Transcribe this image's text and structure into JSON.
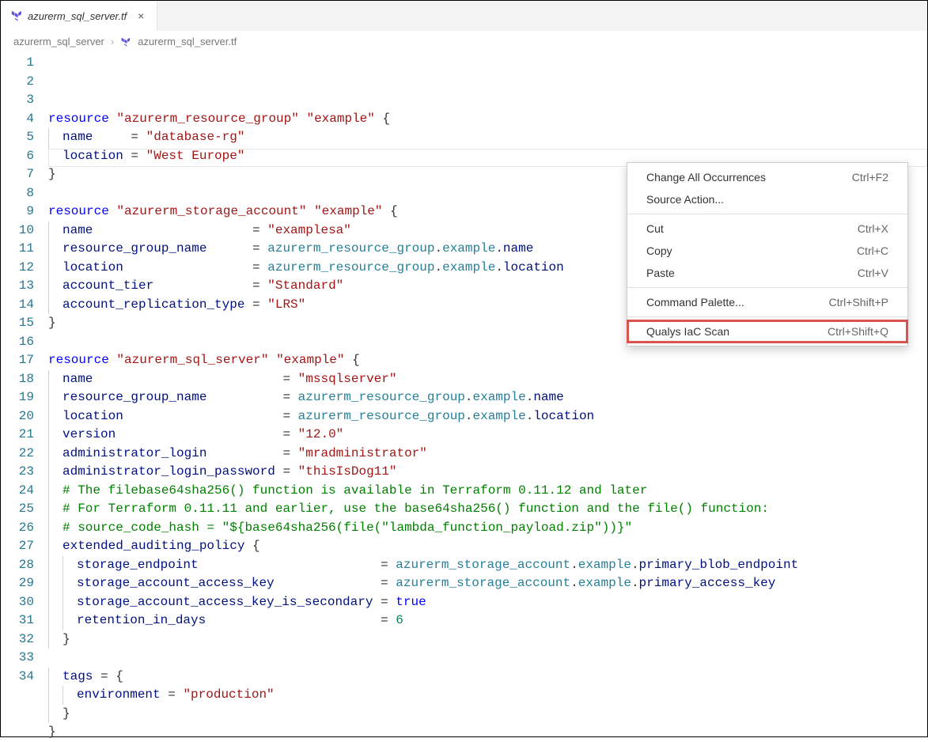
{
  "tab": {
    "filename": "azurerm_sql_server.tf"
  },
  "breadcrumbs": {
    "folder": "azurerm_sql_server",
    "file": "azurerm_sql_server.tf"
  },
  "code": {
    "lines": [
      [
        {
          "t": "kw",
          "v": "resource"
        },
        {
          "t": "",
          "v": " "
        },
        {
          "t": "str",
          "v": "\"azurerm_resource_group\""
        },
        {
          "t": "",
          "v": " "
        },
        {
          "t": "str",
          "v": "\"example\""
        },
        {
          "t": "",
          "v": " {"
        }
      ],
      [
        {
          "ind": 1
        },
        {
          "t": "prop",
          "v": "name"
        },
        {
          "t": "",
          "v": "     = "
        },
        {
          "t": "str",
          "v": "\"database-rg\""
        }
      ],
      [
        {
          "ind": 1
        },
        {
          "t": "prop",
          "v": "location"
        },
        {
          "t": "",
          "v": " = "
        },
        {
          "t": "str",
          "v": "\"West Europe\""
        }
      ],
      [
        {
          "t": "",
          "v": "}"
        }
      ],
      [],
      [
        {
          "t": "kw",
          "v": "resource"
        },
        {
          "t": "",
          "v": " "
        },
        {
          "t": "str",
          "v": "\"azurerm_storage_account\""
        },
        {
          "t": "",
          "v": " "
        },
        {
          "t": "str",
          "v": "\"example\""
        },
        {
          "t": "",
          "v": " {"
        }
      ],
      [
        {
          "ind": 1
        },
        {
          "t": "prop",
          "v": "name"
        },
        {
          "t": "",
          "v": "                     = "
        },
        {
          "t": "str",
          "v": "\"examplesa\""
        }
      ],
      [
        {
          "ind": 1
        },
        {
          "t": "prop",
          "v": "resource_group_name"
        },
        {
          "t": "",
          "v": "      = "
        },
        {
          "t": "ref",
          "v": "azurerm_resource_group"
        },
        {
          "t": "",
          "v": "."
        },
        {
          "t": "ref",
          "v": "example"
        },
        {
          "t": "",
          "v": "."
        },
        {
          "t": "prop",
          "v": "name"
        }
      ],
      [
        {
          "ind": 1
        },
        {
          "t": "prop",
          "v": "location"
        },
        {
          "t": "",
          "v": "                 = "
        },
        {
          "t": "ref",
          "v": "azurerm_resource_group"
        },
        {
          "t": "",
          "v": "."
        },
        {
          "t": "ref",
          "v": "example"
        },
        {
          "t": "",
          "v": "."
        },
        {
          "t": "prop",
          "v": "location"
        }
      ],
      [
        {
          "ind": 1
        },
        {
          "t": "prop",
          "v": "account_tier"
        },
        {
          "t": "",
          "v": "             = "
        },
        {
          "t": "str",
          "v": "\"Standard\""
        }
      ],
      [
        {
          "ind": 1
        },
        {
          "t": "prop",
          "v": "account_replication_type"
        },
        {
          "t": "",
          "v": " = "
        },
        {
          "t": "str",
          "v": "\"LRS\""
        }
      ],
      [
        {
          "t": "",
          "v": "}"
        }
      ],
      [],
      [
        {
          "t": "kw",
          "v": "resource"
        },
        {
          "t": "",
          "v": " "
        },
        {
          "t": "str",
          "v": "\"azurerm_sql_server\""
        },
        {
          "t": "",
          "v": " "
        },
        {
          "t": "str",
          "v": "\"example\""
        },
        {
          "t": "",
          "v": " {"
        }
      ],
      [
        {
          "ind": 1
        },
        {
          "t": "prop",
          "v": "name"
        },
        {
          "t": "",
          "v": "                         = "
        },
        {
          "t": "str",
          "v": "\"mssqlserver\""
        }
      ],
      [
        {
          "ind": 1
        },
        {
          "t": "prop",
          "v": "resource_group_name"
        },
        {
          "t": "",
          "v": "          = "
        },
        {
          "t": "ref",
          "v": "azurerm_resource_group"
        },
        {
          "t": "",
          "v": "."
        },
        {
          "t": "ref",
          "v": "example"
        },
        {
          "t": "",
          "v": "."
        },
        {
          "t": "prop",
          "v": "name"
        }
      ],
      [
        {
          "ind": 1
        },
        {
          "t": "prop",
          "v": "location"
        },
        {
          "t": "",
          "v": "                     = "
        },
        {
          "t": "ref",
          "v": "azurerm_resource_group"
        },
        {
          "t": "",
          "v": "."
        },
        {
          "t": "ref",
          "v": "example"
        },
        {
          "t": "",
          "v": "."
        },
        {
          "t": "prop",
          "v": "location"
        }
      ],
      [
        {
          "ind": 1
        },
        {
          "t": "prop",
          "v": "version"
        },
        {
          "t": "",
          "v": "                      = "
        },
        {
          "t": "str",
          "v": "\"12.0\""
        }
      ],
      [
        {
          "ind": 1
        },
        {
          "t": "prop",
          "v": "administrator_login"
        },
        {
          "t": "",
          "v": "          = "
        },
        {
          "t": "str",
          "v": "\"mradministrator\""
        }
      ],
      [
        {
          "ind": 1
        },
        {
          "t": "prop",
          "v": "administrator_login_password"
        },
        {
          "t": "",
          "v": " = "
        },
        {
          "t": "str",
          "v": "\"thisIsDog11\""
        }
      ],
      [
        {
          "ind": 1
        },
        {
          "t": "cmt",
          "v": "# The filebase64sha256() function is available in Terraform 0.11.12 and later"
        }
      ],
      [
        {
          "ind": 1
        },
        {
          "t": "cmt",
          "v": "# For Terraform 0.11.11 and earlier, use the base64sha256() function and the file() function:"
        }
      ],
      [
        {
          "ind": 1
        },
        {
          "t": "cmt",
          "v": "# source_code_hash = \"${base64sha256(file(\"lambda_function_payload.zip\"))}\""
        }
      ],
      [
        {
          "ind": 1
        },
        {
          "t": "prop",
          "v": "extended_auditing_policy"
        },
        {
          "t": "",
          "v": " {"
        }
      ],
      [
        {
          "ind": 2
        },
        {
          "t": "prop",
          "v": "storage_endpoint"
        },
        {
          "t": "",
          "v": "                        = "
        },
        {
          "t": "ref",
          "v": "azurerm_storage_account"
        },
        {
          "t": "",
          "v": "."
        },
        {
          "t": "ref",
          "v": "example"
        },
        {
          "t": "",
          "v": "."
        },
        {
          "t": "prop",
          "v": "primary_blob_endpoint"
        }
      ],
      [
        {
          "ind": 2
        },
        {
          "t": "prop",
          "v": "storage_account_access_key"
        },
        {
          "t": "",
          "v": "              = "
        },
        {
          "t": "ref",
          "v": "azurerm_storage_account"
        },
        {
          "t": "",
          "v": "."
        },
        {
          "t": "ref",
          "v": "example"
        },
        {
          "t": "",
          "v": "."
        },
        {
          "t": "prop",
          "v": "primary_access_key"
        }
      ],
      [
        {
          "ind": 2
        },
        {
          "t": "prop",
          "v": "storage_account_access_key_is_secondary"
        },
        {
          "t": "",
          "v": " = "
        },
        {
          "t": "bool",
          "v": "true"
        }
      ],
      [
        {
          "ind": 2
        },
        {
          "t": "prop",
          "v": "retention_in_days"
        },
        {
          "t": "",
          "v": "                       = "
        },
        {
          "t": "num",
          "v": "6"
        }
      ],
      [
        {
          "ind": 1
        },
        {
          "t": "",
          "v": "}"
        }
      ],
      [],
      [
        {
          "ind": 1
        },
        {
          "t": "prop",
          "v": "tags"
        },
        {
          "t": "",
          "v": " = {"
        }
      ],
      [
        {
          "ind": 2
        },
        {
          "t": "prop",
          "v": "environment"
        },
        {
          "t": "",
          "v": " = "
        },
        {
          "t": "str",
          "v": "\"production\""
        }
      ],
      [
        {
          "ind": 1
        },
        {
          "t": "",
          "v": "}"
        }
      ],
      [
        {
          "t": "",
          "v": "}"
        }
      ]
    ]
  },
  "contextMenu": {
    "groups": [
      [
        {
          "label": "Change All Occurrences",
          "shortcut": "Ctrl+F2"
        },
        {
          "label": "Source Action..."
        }
      ],
      [
        {
          "label": "Cut",
          "shortcut": "Ctrl+X"
        },
        {
          "label": "Copy",
          "shortcut": "Ctrl+C"
        },
        {
          "label": "Paste",
          "shortcut": "Ctrl+V"
        }
      ],
      [
        {
          "label": "Command Palette...",
          "shortcut": "Ctrl+Shift+P"
        }
      ],
      [
        {
          "label": "Qualys IaC Scan",
          "shortcut": "Ctrl+Shift+Q",
          "highlight": true
        }
      ]
    ]
  }
}
